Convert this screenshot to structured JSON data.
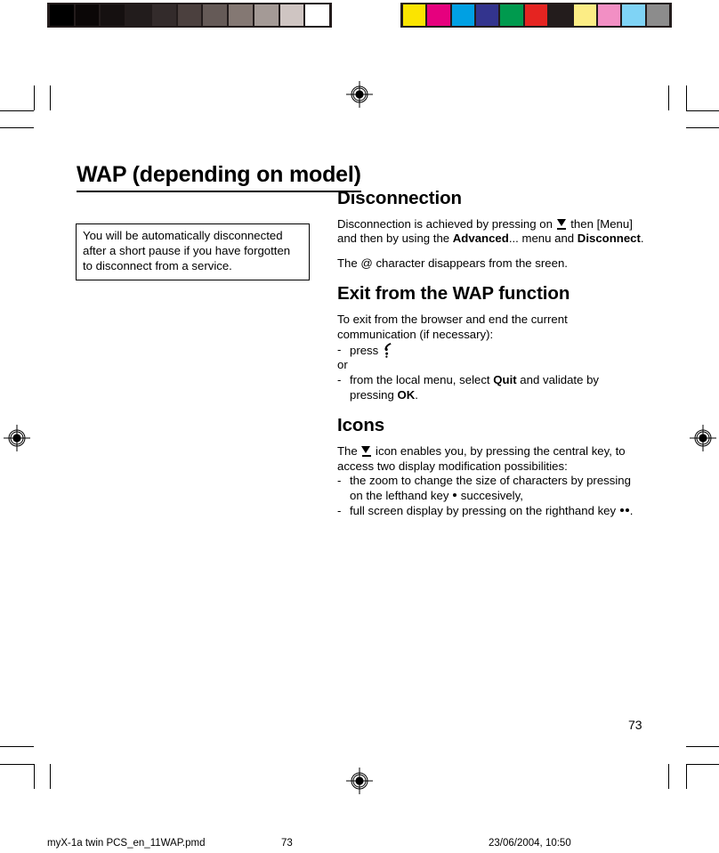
{
  "calibration": {
    "grayscale_label": "grayscale-calibration-bar",
    "grayscale_swatches": [
      "#000000",
      "#0b0707",
      "#151010",
      "#221c1c",
      "#332b2b",
      "#4b403e",
      "#655a57",
      "#847873",
      "#a49a96",
      "#cfc5c2",
      "#ffffff"
    ],
    "color_label": "color-calibration-bar",
    "color_swatches": [
      "#fbe400",
      "#e6007e",
      "#00a0e3",
      "#33348e",
      "#009a4e",
      "#e52421",
      "#231c1c",
      "#fced85",
      "#f28fc4",
      "#7fd3f5",
      "#8c8c8c"
    ]
  },
  "title": {
    "text": "WAP (depending on model)"
  },
  "note": {
    "text": "You will be automatically disconnected after a short pause if you have forgotten to disconnect from a service."
  },
  "sections": {
    "disconnection": {
      "heading": "Disconnection",
      "p1_a": "Disconnection is achieved by pressing on ",
      "p1_b": " then [Menu] and then by using the ",
      "p1_bold1": "Advanced",
      "p1_c": "... menu and ",
      "p1_bold2": "Disconnect",
      "p1_d": ".",
      "p2": "The @ character disappears from the sreen."
    },
    "exit": {
      "heading": "Exit from the WAP function",
      "p1": "To exit from the browser and end the current communication (if necessary):",
      "item1_dash": "-",
      "item1_text": "press ",
      "or": "or",
      "item2_dash": "-",
      "item2_a": "from the local menu, select ",
      "item2_bold1": "Quit",
      "item2_b": " and validate by pressing ",
      "item2_bold2": "OK",
      "item2_c": "."
    },
    "icons": {
      "heading": "Icons",
      "p1_a": "The ",
      "p1_b": " icon enables you, by pressing the central key, to access two display modification possibilities:",
      "item1_dash": "-",
      "item1_a": "the zoom to change the size of characters by pressing on the lefthand key ",
      "item1_b": " succesively,",
      "item2_dash": "-",
      "item2_a": "full screen display by pressing on the righthand key ",
      "item2_b": "."
    }
  },
  "page_number": "73",
  "footer": {
    "file": "myX-1a twin PCS_en_11WAP.pmd",
    "page": "73",
    "date": "23/06/2004, 10:50"
  }
}
